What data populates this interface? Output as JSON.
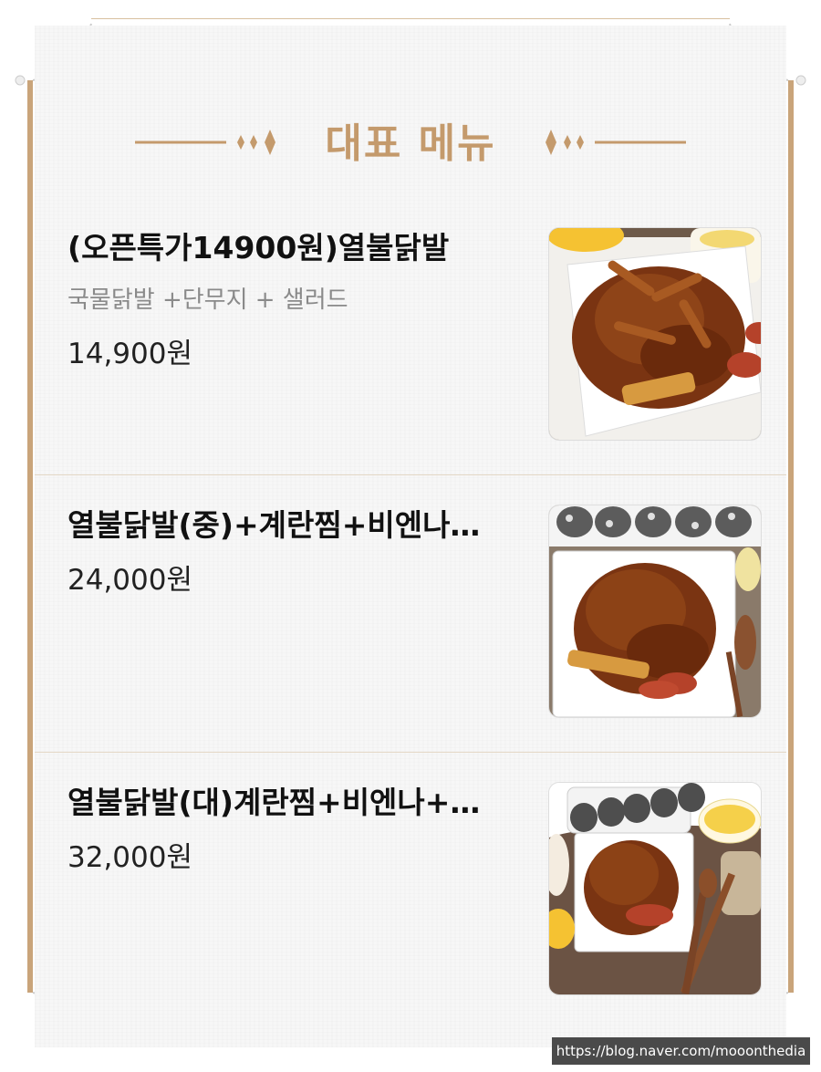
{
  "header": {
    "title": "대표 메뉴",
    "accent_color": "#c49a6c"
  },
  "menu": {
    "items": [
      {
        "name": "(오픈특가14900원)열불닭발",
        "description": "국물닭발 +단무지 + 샐러드",
        "price": "14,900원",
        "image_icon": "spicy-chicken-feet-photo"
      },
      {
        "name": "열불닭발(중)+계란찜+비엔나…",
        "price": "24,000원",
        "image_icon": "chicken-feet-with-rice-balls-photo"
      },
      {
        "name": "열불닭발(대)계란찜+비엔나+…",
        "price": "32,000원",
        "image_icon": "chicken-feet-set-photo"
      }
    ]
  },
  "watermark": {
    "text": "https://blog.naver.com/mooonthedia"
  }
}
